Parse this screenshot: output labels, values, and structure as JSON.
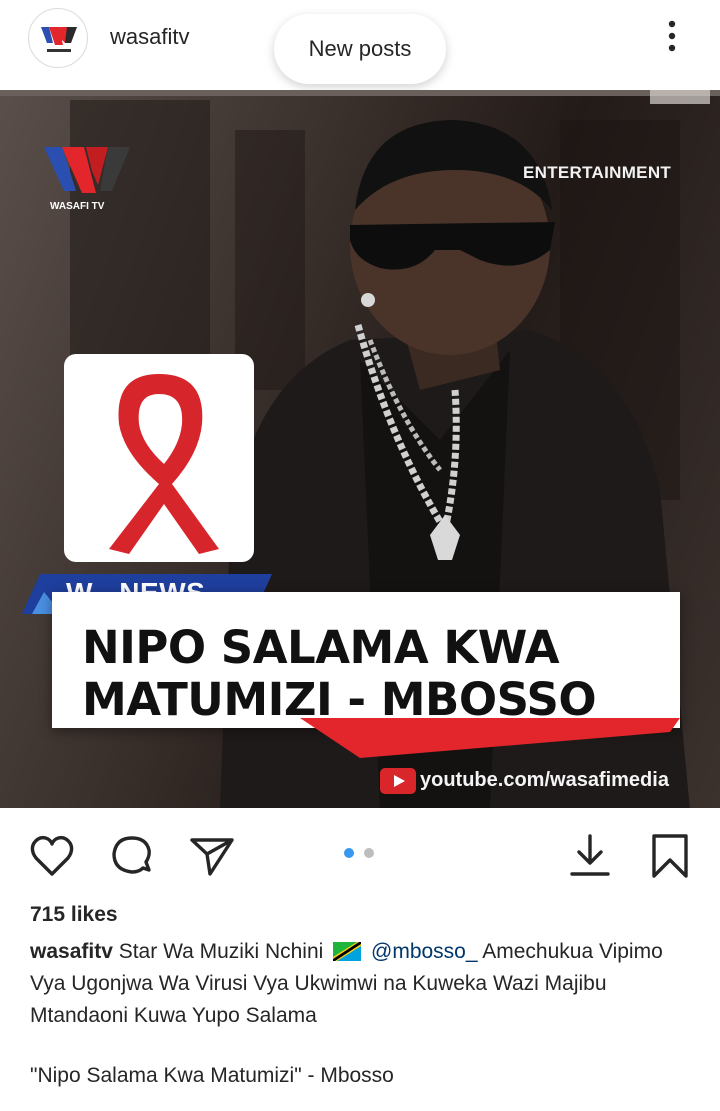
{
  "header": {
    "username": "wasafitv",
    "avatar_icon": "wasafi-tv-logo",
    "new_posts_label": "New posts",
    "more_icon": "more-vertical-icon"
  },
  "post": {
    "brand_label": "WASAFI TV",
    "category": "ENTERTAINMENT",
    "news_tag": "W - NEWS",
    "headline_line1": "NIPO SALAMA KWA",
    "headline_line2": "MATUMIZI - MBOSSO",
    "youtube_url": "youtube.com/wasafimedia",
    "ribbon_color": "#d7262b",
    "accent_blue": "#1f3f9e",
    "accent_red": "#e3262b"
  },
  "actions": {
    "like_icon": "heart-icon",
    "comment_icon": "comment-icon",
    "share_icon": "send-icon",
    "download_icon": "download-icon",
    "save_icon": "bookmark-icon",
    "carousel_pages": 2,
    "carousel_active": 1
  },
  "meta": {
    "likes": "715 likes",
    "caption_user": "wasafitv",
    "caption_part1": "Star Wa Muziki Nchini",
    "mention": "@mbosso_",
    "caption_part2": "Amechukua Vipimo Vya Ugonjwa Wa Virusi Vya  Ukwimwi na Kuweka Wazi Majibu Mtandaoni Kuwa Yupo Salama",
    "quote": "\"Nipo Salama Kwa Matumizi\" - Mbosso"
  }
}
